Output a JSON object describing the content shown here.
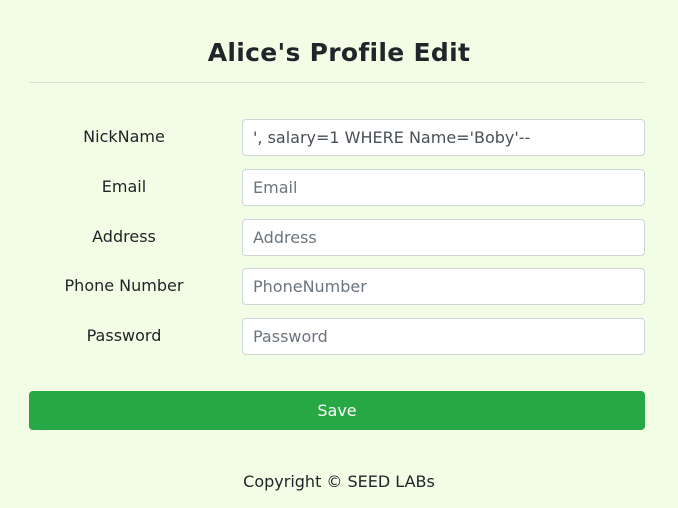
{
  "page": {
    "title": "Alice's Profile Edit"
  },
  "form": {
    "fields": [
      {
        "label": "NickName",
        "value": "', salary=1 WHERE Name='Boby'--",
        "placeholder": ""
      },
      {
        "label": "Email",
        "value": "",
        "placeholder": "Email"
      },
      {
        "label": "Address",
        "value": "",
        "placeholder": "Address"
      },
      {
        "label": "Phone Number",
        "value": "",
        "placeholder": "PhoneNumber"
      },
      {
        "label": "Password",
        "value": "",
        "placeholder": "Password"
      }
    ],
    "save_label": "Save"
  },
  "footer": {
    "copyright": "Copyright © SEED LABs"
  },
  "colors": {
    "page_background": "#f2fde5",
    "save_button": "#28a745"
  }
}
